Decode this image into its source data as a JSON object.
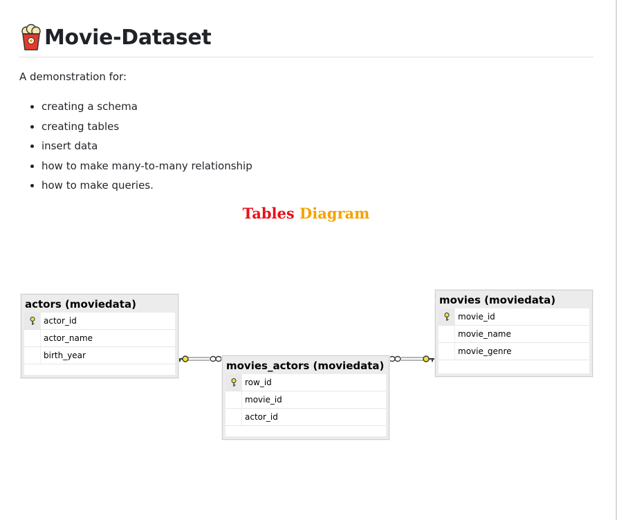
{
  "page": {
    "title": "Movie-Dataset",
    "intro": "A demonstration for:",
    "bullets": [
      "creating a schema",
      "creating tables",
      "insert data",
      "how to make many-to-many relationship",
      "how to make queries."
    ],
    "heading_part1": "Tables",
    "heading_part2": "Diagram"
  },
  "diagram": {
    "tables": [
      {
        "title": "actors (moviedata)",
        "columns": [
          "actor_id",
          "actor_name",
          "birth_year"
        ],
        "primary_key": "actor_id"
      },
      {
        "title": "movies_actors (moviedata)",
        "columns": [
          "row_id",
          "movie_id",
          "actor_id"
        ],
        "primary_key": "row_id"
      },
      {
        "title": "movies (moviedata)",
        "columns": [
          "movie_id",
          "movie_name",
          "movie_genre"
        ],
        "primary_key": "movie_id"
      }
    ]
  },
  "colors": {
    "heading_red": "#e8111a",
    "heading_orange": "#f4a300",
    "key_yellow": "#f2e23a"
  },
  "icons": {
    "logo": "popcorn-icon",
    "pk": "key-icon",
    "many": "infinity-icon"
  }
}
